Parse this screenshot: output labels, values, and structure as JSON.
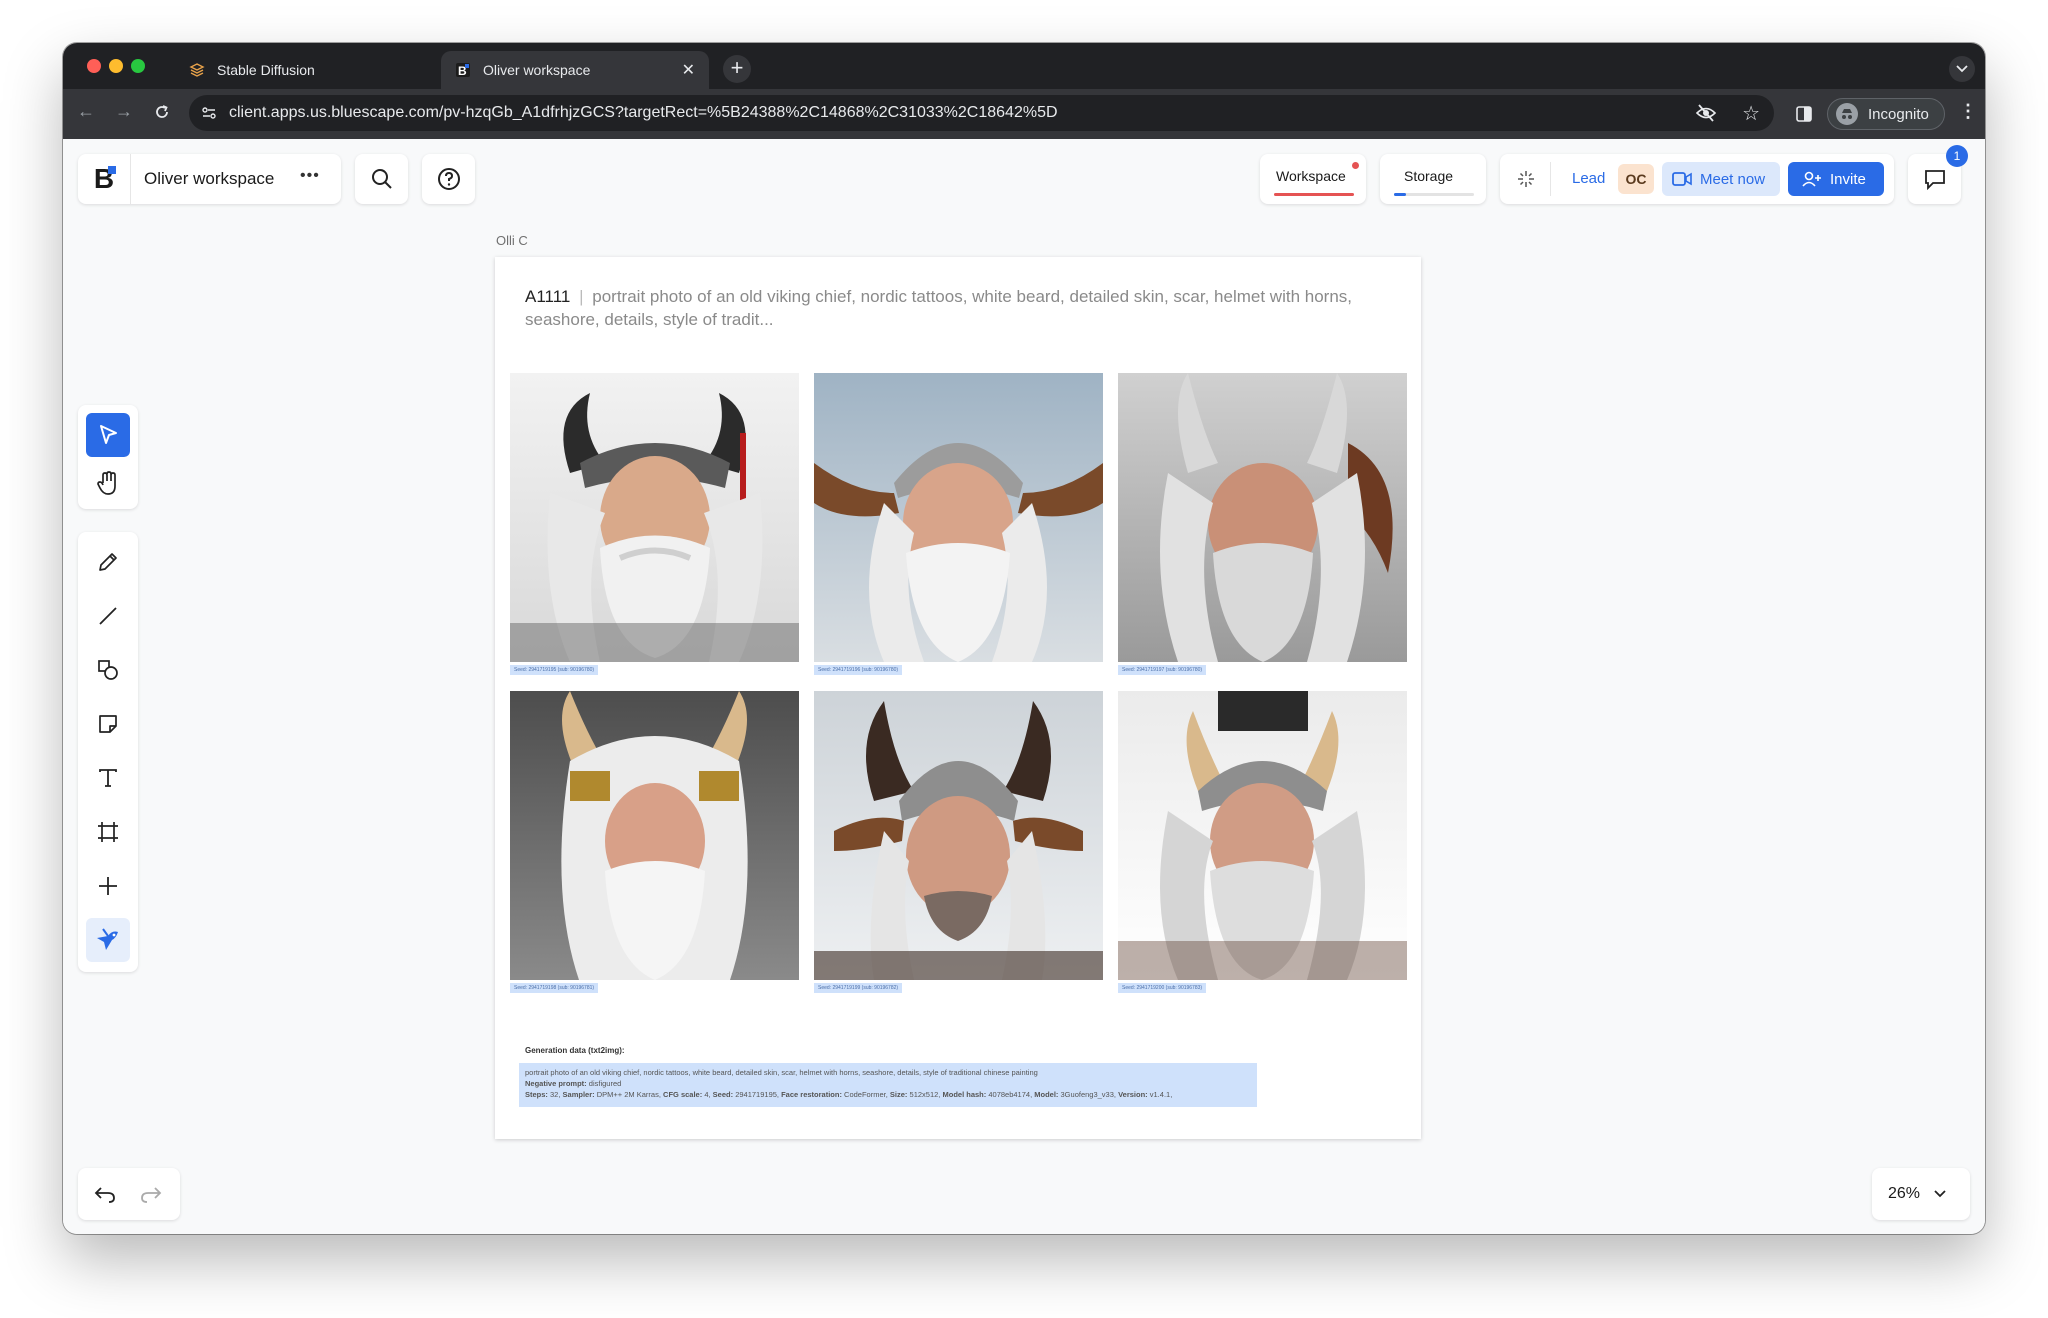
{
  "browser": {
    "tabs": [
      {
        "title": "Stable Diffusion"
      },
      {
        "title": "Oliver workspace"
      }
    ],
    "url": "client.apps.us.bluescape.com/pv-hzqGb_A1dfrhjzGCS?targetRect=%5B24388%2C14868%2C31033%2C18642%5D",
    "incognito_label": "Incognito"
  },
  "header": {
    "logo_letter": "B",
    "workspace_name": "Oliver workspace",
    "more_label": "•••",
    "workspace_tab": "Workspace",
    "storage_tab": "Storage",
    "lead_label": "Lead",
    "avatar_initials": "OC",
    "meet_label": "Meet now",
    "invite_label": "Invite",
    "chat_badge": "1"
  },
  "canvas": {
    "author": "Olli C",
    "card_source": "A1111",
    "card_separator": "|",
    "card_prompt": "portrait photo of an old viking chief, nordic tattoos, white beard, detailed skin, scar, helmet with horns, seashore, details, style of tradit...",
    "seeds": [
      "Seed: 2941719195 (sub: 90196780)",
      "Seed: 2941719196 (sub: 90196780)",
      "Seed: 2941719197 (sub: 90196780)",
      "Seed: 2941719198 (sub: 90196781)",
      "Seed: 2941719199 (sub: 90196782)",
      "Seed: 2941719200 (sub: 90196783)"
    ],
    "generation_title": "Generation data (txt2img):",
    "generation_prompt": "portrait photo of an old viking chief, nordic tattoos, white beard, detailed skin, scar, helmet with horns, seashore, details, style of traditional chinese painting",
    "negative_label": "Negative prompt:",
    "negative_value": "disfigured",
    "params": [
      {
        "k": "Steps:",
        "v": "32,"
      },
      {
        "k": "Sampler:",
        "v": "DPM++ 2M Karras,"
      },
      {
        "k": "CFG scale:",
        "v": "4,"
      },
      {
        "k": "Seed:",
        "v": "2941719195,"
      },
      {
        "k": "Face restoration:",
        "v": "CodeFormer,"
      },
      {
        "k": "Size:",
        "v": "512x512,"
      },
      {
        "k": "Model hash:",
        "v": "4078eb4174,"
      },
      {
        "k": "Model:",
        "v": "3Guofeng3_v33,"
      },
      {
        "k": "Version:",
        "v": "v1.4.1,"
      }
    ]
  },
  "footer": {
    "zoom": "26%"
  },
  "colors": {
    "accent": "#2a6be6",
    "accent_light": "#dce8fb",
    "workspace_underline": "#e55353",
    "chrome_dark": "#202124",
    "chrome_mid": "#35363a"
  },
  "icons": [
    "select-arrow-icon",
    "hand-icon",
    "pen-icon",
    "line-icon",
    "shapes-icon",
    "sticky-note-icon",
    "text-icon",
    "frame-icon",
    "plus-icon",
    "ai-bird-icon",
    "search-icon",
    "help-icon",
    "undo-icon",
    "redo-icon",
    "chat-icon",
    "video-icon",
    "add-person-icon"
  ]
}
